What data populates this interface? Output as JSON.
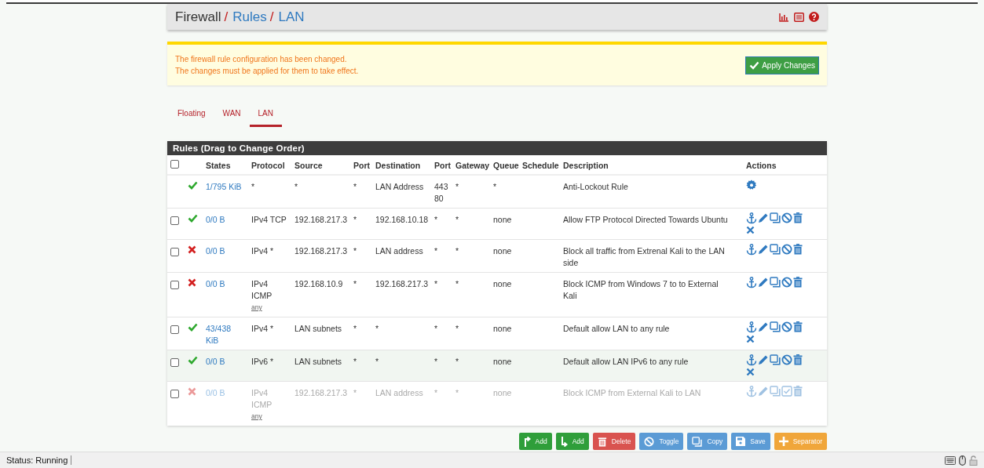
{
  "breadcrumb": [
    {
      "label": "Firewall",
      "link": false,
      "separator": "/"
    },
    {
      "label": "Rules",
      "link": true,
      "separator": "/"
    },
    {
      "label": "LAN",
      "link": true
    }
  ],
  "header_icons": [
    {
      "kind": "chart"
    },
    {
      "kind": "list"
    },
    {
      "kind": "help"
    }
  ],
  "alert": {
    "lines": [
      "The firewall rule configuration has been changed.",
      "The changes must be applied for them to take effect."
    ],
    "button": "Apply Changes"
  },
  "tabs": [
    {
      "label": "Floating",
      "selected": false
    },
    {
      "label": "WAN",
      "selected": false
    },
    {
      "label": "LAN",
      "selected": true
    }
  ],
  "table": {
    "title": "Rules (Drag to Change Order)",
    "select_all": {
      "checked": false
    },
    "columns": [
      "States",
      "Protocol",
      "Source",
      "Port",
      "Destination",
      "Port",
      "Gateway",
      "Queue",
      "Schedule",
      "Description",
      "Actions"
    ],
    "rows": [
      {
        "blocked": false,
        "disabled": false,
        "highlighted": false,
        "states": "1/795 KiB",
        "protocol": "*",
        "source": "*",
        "source_port": "*",
        "destination": "LAN Address",
        "dest_port": [
          "443",
          "80"
        ],
        "gateway": "*",
        "queue": "*",
        "description": "Anti-Lockout Rule",
        "actions": [
          {
            "kind": "gear"
          }
        ]
      },
      {
        "checked": false,
        "blocked": false,
        "disabled": false,
        "highlighted": false,
        "states": "0/0 B",
        "protocol": "IPv4 TCP",
        "source": "192.168.217.3",
        "source_port": "*",
        "destination": "192.168.10.18",
        "dest_port": [
          "*"
        ],
        "gateway": "*",
        "queue": "none",
        "description": "Allow FTP Protocol Directed Towards Ubuntu",
        "actions": [
          {
            "kind": "anchor"
          },
          {
            "kind": "edit"
          },
          {
            "kind": "copy"
          },
          {
            "kind": "toggle"
          },
          {
            "kind": "delete"
          },
          {
            "kind": "x"
          }
        ]
      },
      {
        "checked": false,
        "blocked": true,
        "disabled": false,
        "highlighted": false,
        "states": "0/0 B",
        "protocol": "IPv4 *",
        "source": "192.168.217.3",
        "source_port": "*",
        "destination": "LAN address",
        "dest_port": [
          "*"
        ],
        "gateway": "*",
        "queue": "none",
        "description": "Block all traffic from Extrenal Kali to the LAN side",
        "actions": [
          {
            "kind": "anchor"
          },
          {
            "kind": "edit"
          },
          {
            "kind": "copy"
          },
          {
            "kind": "toggle"
          },
          {
            "kind": "delete"
          }
        ]
      },
      {
        "checked": false,
        "blocked": true,
        "disabled": false,
        "highlighted": false,
        "states": "0/0 B",
        "protocol": "IPv4 ICMP",
        "protocol_sub": "any",
        "source": "192.168.10.9",
        "source_port": "*",
        "destination": "192.168.217.3",
        "dest_port": [
          "*"
        ],
        "gateway": "*",
        "queue": "none",
        "description": "Block ICMP from Windows 7 to to External Kali",
        "actions": [
          {
            "kind": "anchor"
          },
          {
            "kind": "edit"
          },
          {
            "kind": "copy"
          },
          {
            "kind": "toggle"
          },
          {
            "kind": "delete"
          }
        ]
      },
      {
        "checked": false,
        "blocked": false,
        "disabled": false,
        "highlighted": false,
        "states": "43/438 KiB",
        "protocol": "IPv4 *",
        "source": "LAN subnets",
        "source_port": "*",
        "destination": "*",
        "dest_port": [
          "*"
        ],
        "gateway": "*",
        "queue": "none",
        "description": "Default allow LAN to any rule",
        "actions": [
          {
            "kind": "anchor"
          },
          {
            "kind": "edit"
          },
          {
            "kind": "copy"
          },
          {
            "kind": "toggle"
          },
          {
            "kind": "delete"
          },
          {
            "kind": "x"
          }
        ]
      },
      {
        "checked": false,
        "blocked": false,
        "disabled": false,
        "highlighted": true,
        "states": "0/0 B",
        "protocol": "IPv6 *",
        "source": "LAN subnets",
        "source_port": "*",
        "destination": "*",
        "dest_port": [
          "*"
        ],
        "gateway": "*",
        "queue": "none",
        "description": "Default allow LAN IPv6 to any rule",
        "actions": [
          {
            "kind": "anchor"
          },
          {
            "kind": "edit"
          },
          {
            "kind": "copy"
          },
          {
            "kind": "toggle"
          },
          {
            "kind": "delete"
          },
          {
            "kind": "x"
          }
        ]
      },
      {
        "checked": false,
        "blocked": true,
        "disabled": true,
        "highlighted": false,
        "states": "0/0 B",
        "protocol": "IPv4 ICMP",
        "protocol_sub": "any",
        "source": "192.168.217.3",
        "source_port": "*",
        "destination": "LAN address",
        "dest_port": [
          "*"
        ],
        "gateway": "*",
        "queue": "none",
        "description": "Block ICMP from External Kali to LAN",
        "actions": [
          {
            "kind": "anchor"
          },
          {
            "kind": "edit"
          },
          {
            "kind": "copy"
          },
          {
            "kind": "enable"
          },
          {
            "kind": "delete"
          }
        ]
      }
    ]
  },
  "buttons": [
    {
      "kind": "add-top",
      "label": "Add"
    },
    {
      "kind": "add-bottom",
      "label": "Add"
    },
    {
      "kind": "delete",
      "label": "Delete"
    },
    {
      "kind": "toggle",
      "label": "Toggle"
    },
    {
      "kind": "copy",
      "label": "Copy"
    },
    {
      "kind": "save",
      "label": "Save"
    },
    {
      "kind": "separator",
      "label": "Separator"
    }
  ],
  "status_bar": {
    "text": "Status: Running",
    "icons": [
      {
        "kind": "keyboard"
      },
      {
        "kind": "mouse"
      },
      {
        "kind": "lock"
      }
    ]
  }
}
